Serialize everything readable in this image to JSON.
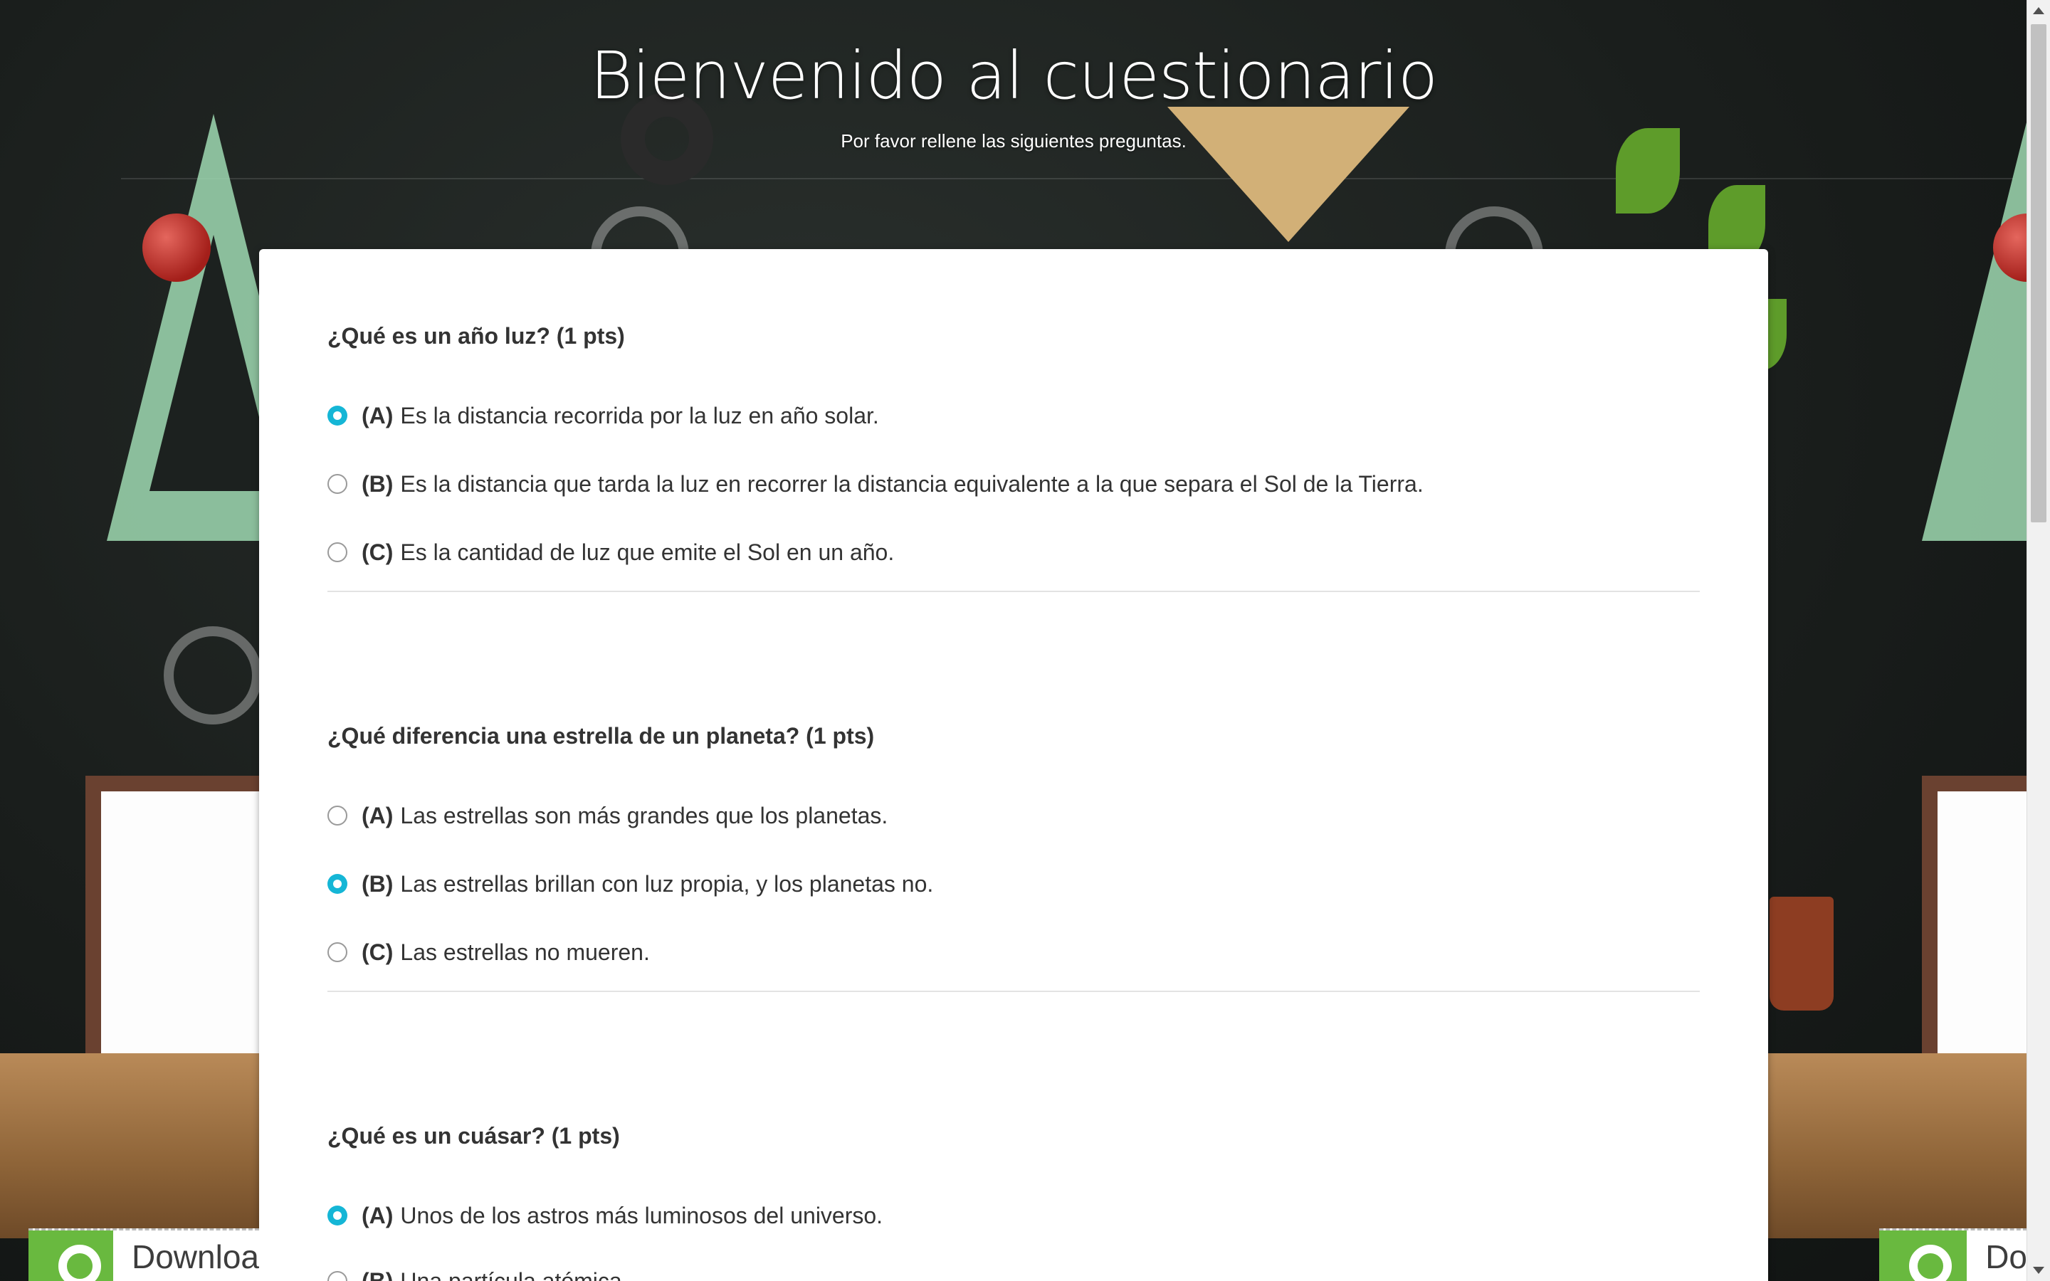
{
  "header": {
    "title": "Bienvenido al cuestionario",
    "subtitle": "Por favor rellene las siguientes preguntas."
  },
  "questions": [
    {
      "text": "¿Qué es un año luz? (1 pts)",
      "options": [
        {
          "letter": "(A)",
          "text": "Es la distancia recorrida por la luz en año solar.",
          "selected": true
        },
        {
          "letter": "(B)",
          "text": "Es la distancia que tarda la luz en recorrer la distancia equivalente a la que separa el Sol de la Tierra.",
          "selected": false
        },
        {
          "letter": "(C)",
          "text": "Es la cantidad de luz que emite el Sol en un año.",
          "selected": false
        }
      ]
    },
    {
      "text": "¿Qué diferencia una estrella de un planeta? (1 pts)",
      "options": [
        {
          "letter": "(A)",
          "text": "Las estrellas son más grandes que los planetas.",
          "selected": false
        },
        {
          "letter": "(B)",
          "text": "Las estrellas brillan con luz propia, y los planetas no.",
          "selected": true
        },
        {
          "letter": "(C)",
          "text": "Las estrellas no mueren.",
          "selected": false
        }
      ]
    },
    {
      "text": "¿Qué es un cuásar? (1 pts)",
      "options": [
        {
          "letter": "(A)",
          "text": "Unos de los astros más luminosos del universo.",
          "selected": true
        },
        {
          "letter": "(B)",
          "text": "Una partícula atómica.",
          "selected": false
        }
      ]
    }
  ],
  "ads": {
    "left_text": "Downloa",
    "right_text": "Do"
  },
  "colors": {
    "accent": "#15b6d6",
    "text": "#333333",
    "card": "#ffffff"
  }
}
